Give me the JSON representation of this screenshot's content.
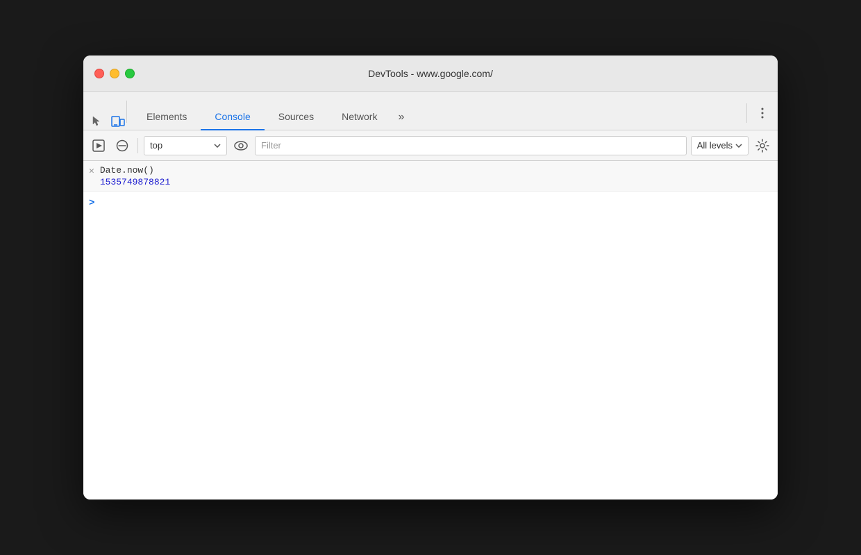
{
  "window": {
    "title": "DevTools - www.google.com/"
  },
  "titlebar": {
    "traffic_lights": {
      "close_label": "close",
      "minimize_label": "minimize",
      "maximize_label": "maximize"
    }
  },
  "tabs": {
    "items": [
      {
        "id": "elements",
        "label": "Elements",
        "active": false
      },
      {
        "id": "console",
        "label": "Console",
        "active": true
      },
      {
        "id": "sources",
        "label": "Sources",
        "active": false
      },
      {
        "id": "network",
        "label": "Network",
        "active": false
      }
    ],
    "more_label": "»"
  },
  "toolbar": {
    "context": {
      "value": "top",
      "placeholder": "top"
    },
    "filter": {
      "placeholder": "Filter"
    },
    "levels": {
      "label": "All levels"
    }
  },
  "console": {
    "entries": [
      {
        "expression": "Date.now()",
        "result": "1535749878821"
      }
    ],
    "input_prompt": ">",
    "input_value": ""
  }
}
